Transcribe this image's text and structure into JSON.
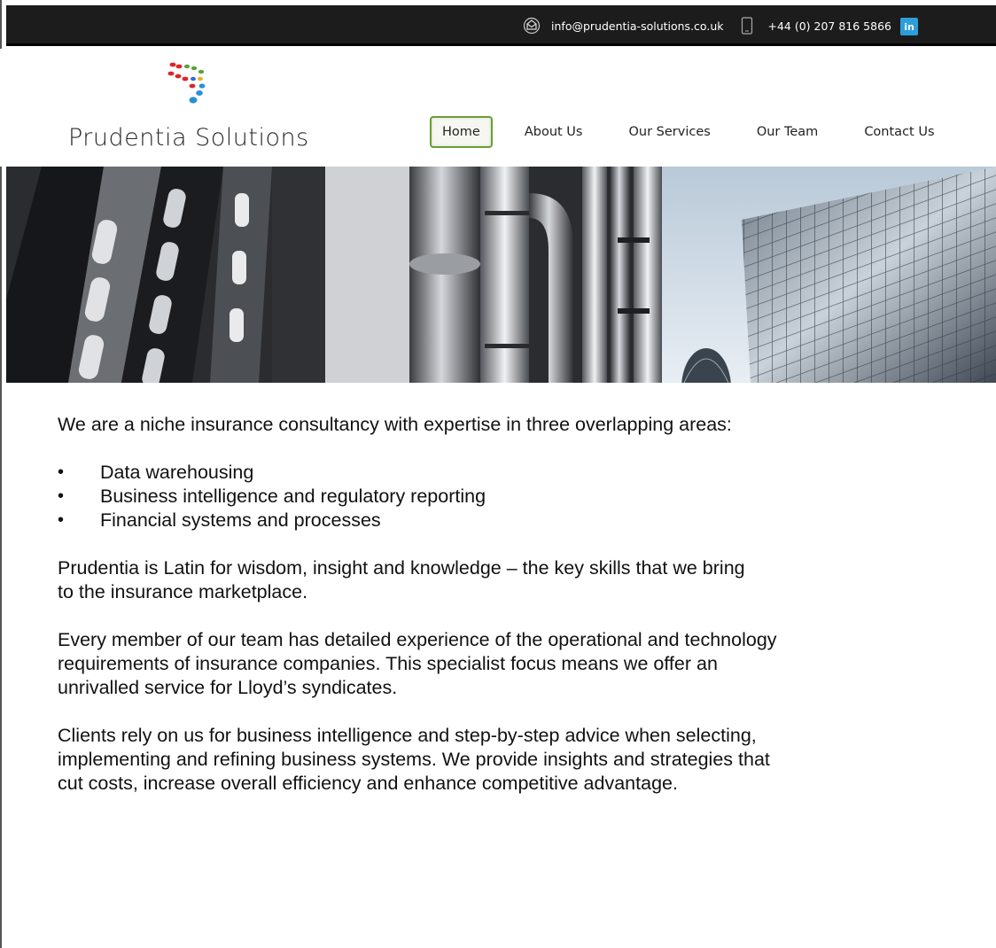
{
  "topbar": {
    "email": "info@prudentia-solutions.co.uk",
    "phone": "+44 (0) 207 816 5866",
    "linkedin_label": "in"
  },
  "brand": {
    "name": "Prudentia Solutions"
  },
  "nav": {
    "items": [
      {
        "label": "Home",
        "active": true
      },
      {
        "label": "About Us"
      },
      {
        "label": "Our Services"
      },
      {
        "label": "Our Team"
      },
      {
        "label": "Contact Us"
      }
    ]
  },
  "content": {
    "intro": "We are a niche insurance consultancy with expertise in three overlapping areas:",
    "areas": [
      "Data warehousing",
      "Business intelligence and regulatory reporting",
      "Financial systems and processes"
    ],
    "paragraph1_line1": "Prudentia is Latin for wisdom, insight and knowledge – the key skills that we bring",
    "paragraph1_line2": "to the insurance marketplace.",
    "paragraph2_line1": "Every member of our team has detailed experience of the operational and technology",
    "paragraph2_line2": "requirements of insurance companies. This specialist focus means we offer an",
    "paragraph2_line3": "unrivalled service for Lloyd’s syndicates.",
    "paragraph3_line1": "Clients rely on us for business intelligence and step-by-step advice when selecting,",
    "paragraph3_line2": "implementing and refining business systems. We provide insights and strategies that",
    "paragraph3_line3": "cut costs, increase overall efficiency and enhance competitive advantage."
  },
  "icons": {
    "email": "envelope-icon",
    "phone": "mobile-phone-icon",
    "linkedin": "linkedin-icon"
  },
  "colors": {
    "topbar_bg": "#1c1c1c",
    "nav_active_border": "#6a9f34",
    "linkedin_blue": "#2c9fd8"
  }
}
